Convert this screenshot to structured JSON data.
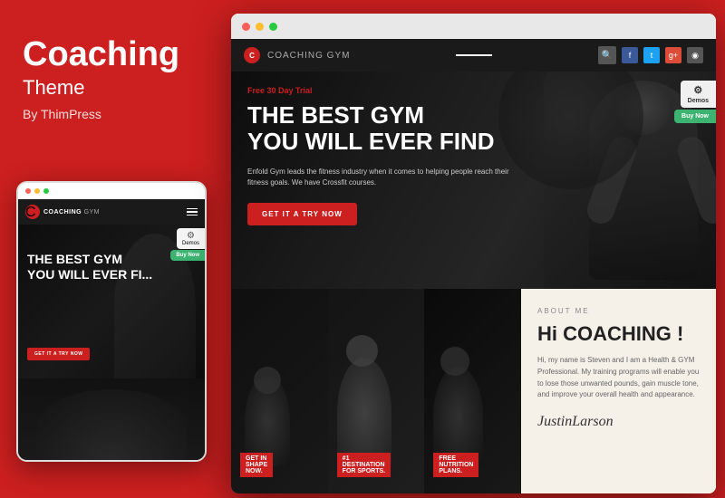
{
  "left": {
    "title": "Coaching",
    "subtitle": "Theme",
    "by": "By ThimPress"
  },
  "mobile": {
    "nav": {
      "logo": "COACHING",
      "logo_suffix": " GYM"
    },
    "hero": {
      "title": "THE BEST GYM\nYOU WILL EVER FI...",
      "cta": "GET IT A TRY NOW"
    },
    "demos_label": "Demos",
    "buy_label": "Buy Now"
  },
  "browser": {
    "dots": [
      "red",
      "yellow",
      "green"
    ],
    "nav": {
      "logo": "COACHING",
      "logo_suffix": " GYM"
    },
    "hero": {
      "trial_badge": "Free 30 Day Trial",
      "title_line1": "THE BEST GYM",
      "title_line2": "YOU WILL EVER FIND",
      "description": "Enfold Gym leads the fitness industry when it comes to helping people reach their fitness goals. We have Crossfit courses.",
      "cta": "GET IT A TRY NOW"
    },
    "demos_label": "Demos",
    "buy_label": "Buy Now",
    "cards": [
      {
        "label": "GET IN\nSHAPE\nNOW."
      },
      {
        "label": "#1\nDESTINATION\nFOR SPORTS."
      },
      {
        "label": "FREE\nNUTRITION\nPLANS."
      }
    ],
    "about": {
      "tag": "ABOUT ME",
      "title": "Hi COACHING !",
      "text": "Hi, my name is Steven and I am a Health & GYM Professional. My training programs will enable you to lose those unwanted pounds, gain muscle tone, and improve your overall health and appearance.",
      "signature": "JustinLarson"
    }
  }
}
